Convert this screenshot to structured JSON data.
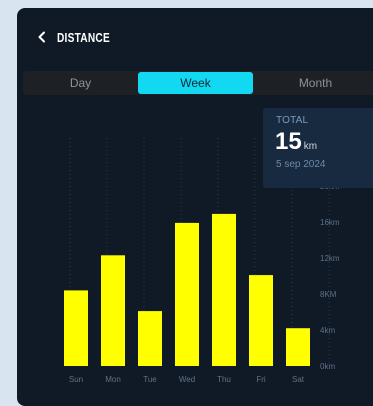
{
  "header": {
    "title": "DISTANCE"
  },
  "tabs": [
    {
      "label": "Day",
      "active": false
    },
    {
      "label": "Week",
      "active": true
    },
    {
      "label": "Month",
      "active": false
    }
  ],
  "total": {
    "label": "TOTAL",
    "value": "15",
    "unit": "km",
    "date": "5 sep 2024"
  },
  "colors": {
    "background": "#0f1a26",
    "accent": "#12d8f2",
    "bar": "#ffff00",
    "total_box": "#182a40"
  },
  "icons": {
    "back": "chevron-left-icon"
  },
  "chart_data": {
    "type": "bar",
    "categories": [
      "Sun",
      "Mon",
      "Tue",
      "Wed",
      "Thu",
      "Fri",
      "Sat"
    ],
    "values": [
      8.4,
      12.3,
      6.1,
      15.9,
      16.9,
      10.1,
      4.2
    ],
    "y_ticks": [
      "0km",
      "4km",
      "8KM",
      "12km",
      "16km",
      "20km"
    ],
    "y_tick_values": [
      0,
      4,
      8,
      12,
      16,
      20
    ],
    "ylim": [
      0,
      20
    ],
    "grid": "vertical dotted lines between categories",
    "y_axis_side": "right"
  }
}
